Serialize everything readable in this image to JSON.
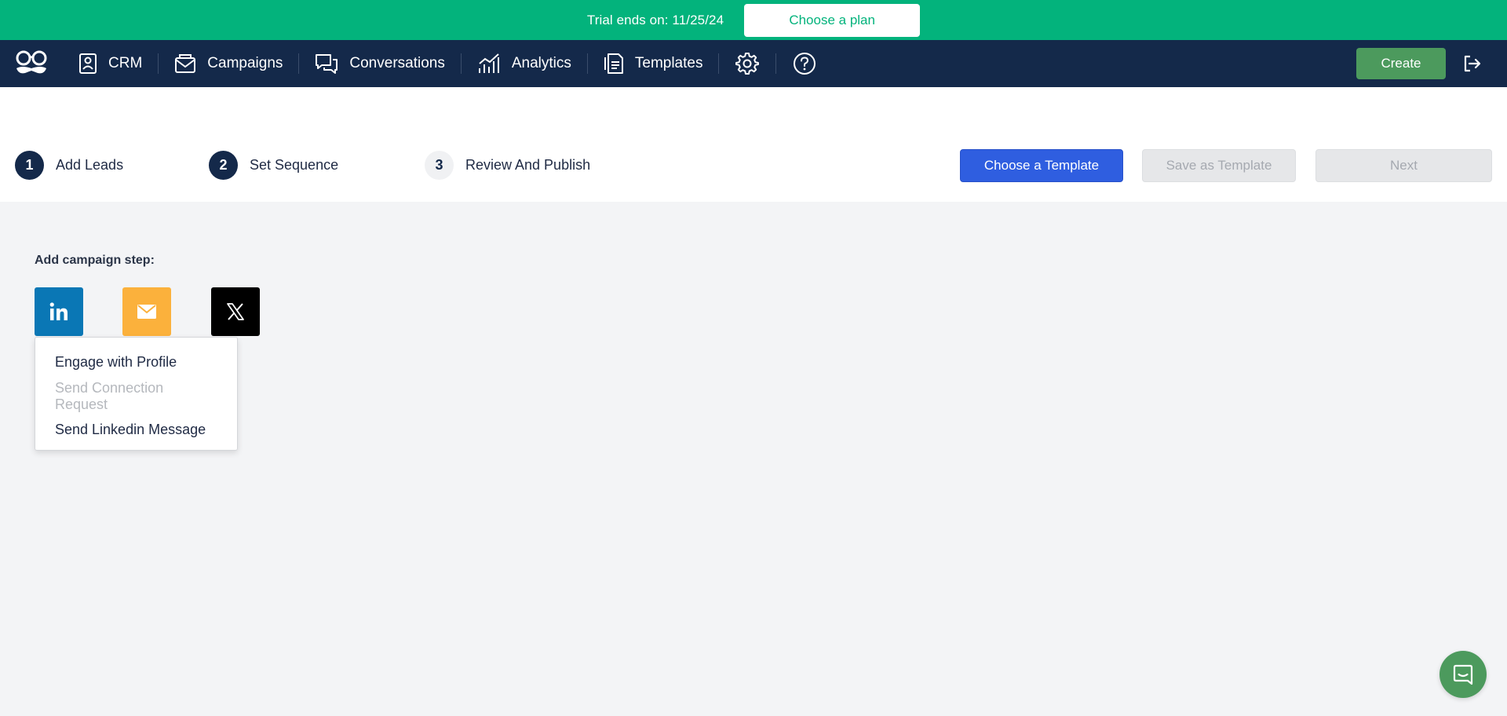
{
  "banner": {
    "trial_text": "Trial ends on: 11/25/24",
    "choose_plan_label": "Choose a plan"
  },
  "nav": {
    "logo_icon": "mustache-glasses-logo-icon",
    "items": [
      {
        "label": "CRM",
        "icon": "contact-card-icon"
      },
      {
        "label": "Campaigns",
        "icon": "envelope-icon"
      },
      {
        "label": "Conversations",
        "icon": "chat-bubbles-icon"
      },
      {
        "label": "Analytics",
        "icon": "bar-chart-icon"
      },
      {
        "label": "Templates",
        "icon": "document-icon"
      }
    ],
    "settings_icon": "gear-icon",
    "help_icon": "help-circle-icon",
    "create_label": "Create",
    "logout_icon": "logout-icon"
  },
  "stepper": {
    "steps": [
      {
        "number": "1",
        "label": "Add Leads",
        "state": "done"
      },
      {
        "number": "2",
        "label": "Set Sequence",
        "state": "done"
      },
      {
        "number": "3",
        "label": "Review And Publish",
        "state": "pending"
      }
    ],
    "choose_template_label": "Choose a Template",
    "save_template_label": "Save as Template",
    "next_label": "Next"
  },
  "main": {
    "add_step_label": "Add campaign step:",
    "channels": [
      {
        "name": "linkedin",
        "icon": "linkedin-icon",
        "color": "#0a77b5"
      },
      {
        "name": "email",
        "icon": "envelope-icon",
        "color": "#fbb13c"
      },
      {
        "name": "x",
        "icon": "x-logo-icon",
        "color": "#000000"
      }
    ],
    "linkedin_menu": [
      {
        "label": "Engage with Profile",
        "disabled": false
      },
      {
        "label": "Send Connection Request",
        "disabled": true
      },
      {
        "label": "Send Linkedin Message",
        "disabled": false
      }
    ]
  },
  "chat_widget_icon": "chat-icon",
  "colors": {
    "banner_green": "#03b37c",
    "nav_navy": "#14294a",
    "create_green": "#4c9a5d",
    "primary_blue": "#2f5ee0"
  }
}
